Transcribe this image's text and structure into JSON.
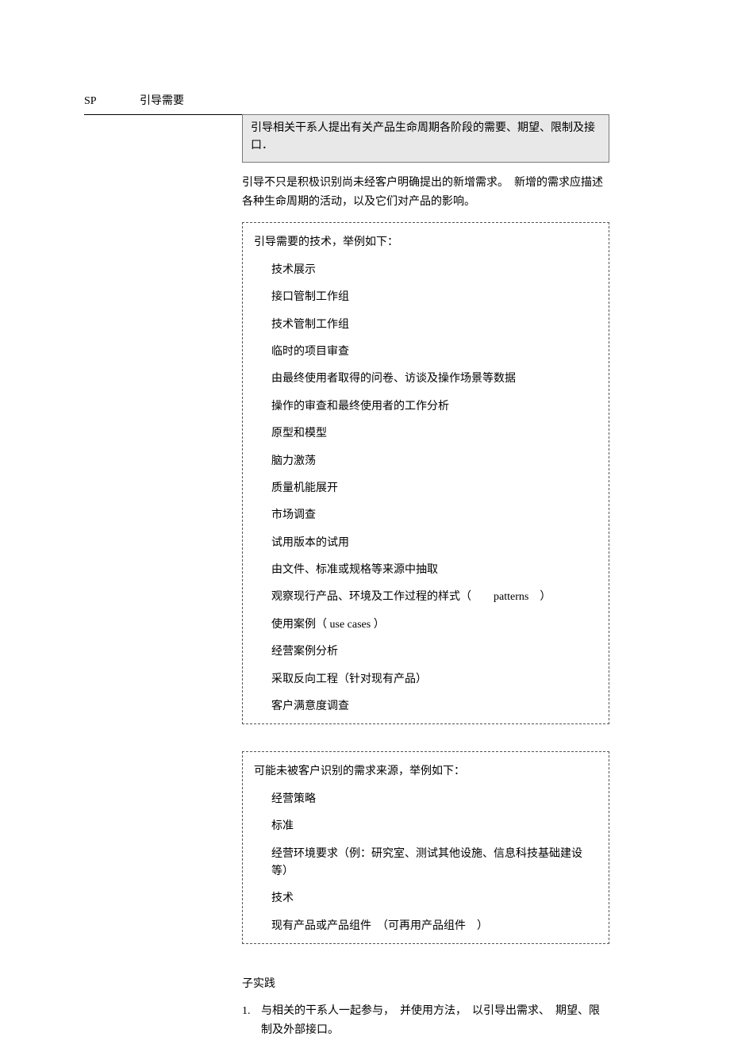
{
  "header": {
    "sp": "SP",
    "title": "引导需要"
  },
  "shaded": "引导相关干系人提出有关产品生命周期各阶段的需要、期望、限制及接口．",
  "para1": "引导不只是积极识别尚未经客户明确提出的新增需求。　新增的需求应描述各种生命周期的活动，以及它们对产品的影响。",
  "box1": {
    "title": "引导需要的技术，举例如下：",
    "items": [
      "技术展示",
      "接口管制工作组",
      "技术管制工作组",
      "临时的项目审查",
      "由最终使用者取得的问卷、访谈及操作场景等数据",
      "操作的审查和最终使用者的工作分析",
      "原型和模型",
      "脑力激荡",
      "质量机能展开",
      "市场调查",
      "试用版本的试用",
      "由文件、标准或规格等来源中抽取",
      "观察现行产品、环境及工作过程的样式（　　patterns　）",
      "使用案例（ use cases ）",
      "经营案例分析",
      "采取反向工程（针对现有产品）",
      "客户满意度调查"
    ]
  },
  "box2": {
    "title": "可能未被客户识别的需求来源，举例如下：",
    "items": [
      "经营策略",
      "标准",
      "经营环境要求（例：研究室、测试其他设施、信息科技基础建设等）",
      "技术",
      "现有产品或产品组件　（可再用产品组件　）"
    ]
  },
  "sub_heading": "子实践",
  "numbered": {
    "num": "1.",
    "text": "与相关的干系人一起参与，　并使用方法，　以引导出需求、　期望、限制及外部接口。"
  }
}
